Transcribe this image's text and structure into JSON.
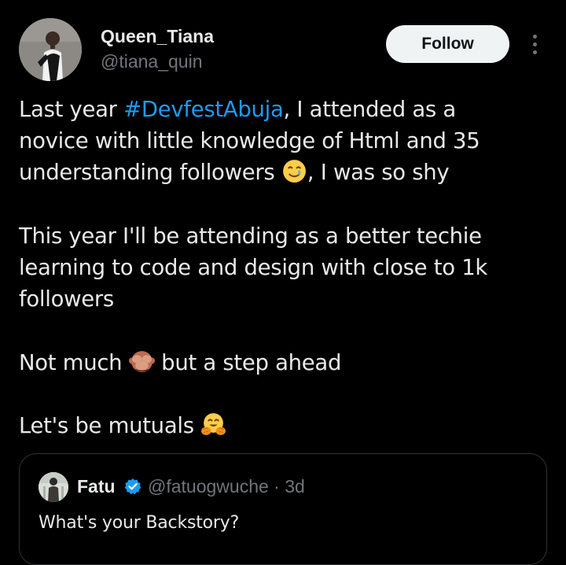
{
  "author": {
    "display_name": "Queen_Tiana",
    "handle": "@tiana_quin"
  },
  "follow_label": "Follow",
  "tweet": {
    "p1": {
      "before": "Last year ",
      "hashtag": "#DevfestAbuja",
      "line1_after": ", I attended as a",
      "line2": "novice with little knowledge of Html and 35",
      "line3_before": "understanding followers ",
      "emoji": "smiling-face-with-tear",
      "line3_after": ", I was so shy"
    },
    "p2": {
      "line1": "This year I'll be attending as a better techie",
      "line2": "learning to code and design with close to 1k",
      "line3": "followers"
    },
    "p3": {
      "before": "Not much ",
      "emoji": "see-no-evil-monkey",
      "after": " but a step ahead"
    },
    "p4": {
      "before": "Let's be mutuals ",
      "emoji": "hugging-face"
    }
  },
  "quoted_tweet": {
    "display_name": "Fatu",
    "verified": true,
    "handle": "@fatuogwuche",
    "separator": "·",
    "time": "3d",
    "text": "What's your Backstory?"
  },
  "colors": {
    "background": "#000000",
    "text": "#e7e9ea",
    "secondary_text": "#71767b",
    "link": "#1d9bf0",
    "border": "#2f3336",
    "follow_button": "#eff3f4"
  }
}
